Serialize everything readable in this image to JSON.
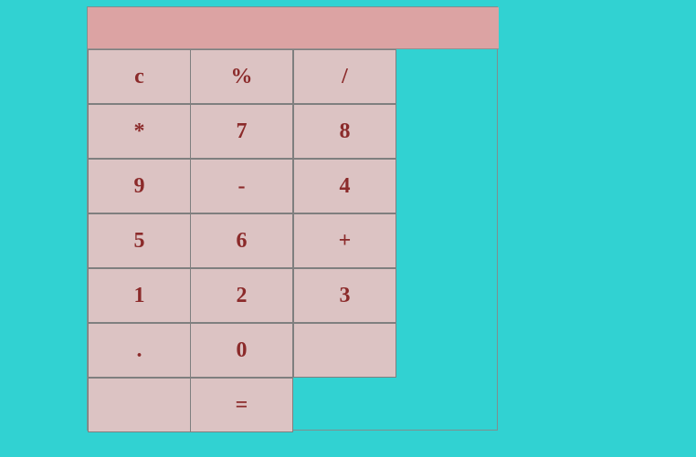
{
  "display": {
    "value": ""
  },
  "keys": {
    "clear": "c",
    "percent": "%",
    "divide": "/",
    "multiply": "*",
    "seven": "7",
    "eight": "8",
    "nine": "9",
    "minus": "-",
    "four": "4",
    "five": "5",
    "six": "6",
    "plus": "+",
    "one": "1",
    "two": "2",
    "three": "3",
    "decimal": ".",
    "zero": "0",
    "blank_a": "",
    "blank_b": "",
    "equals": "="
  },
  "colors": {
    "background": "#31d2d2",
    "display": "#dca3a3",
    "key": "#dcc3c3",
    "text": "#8b2a2a"
  }
}
